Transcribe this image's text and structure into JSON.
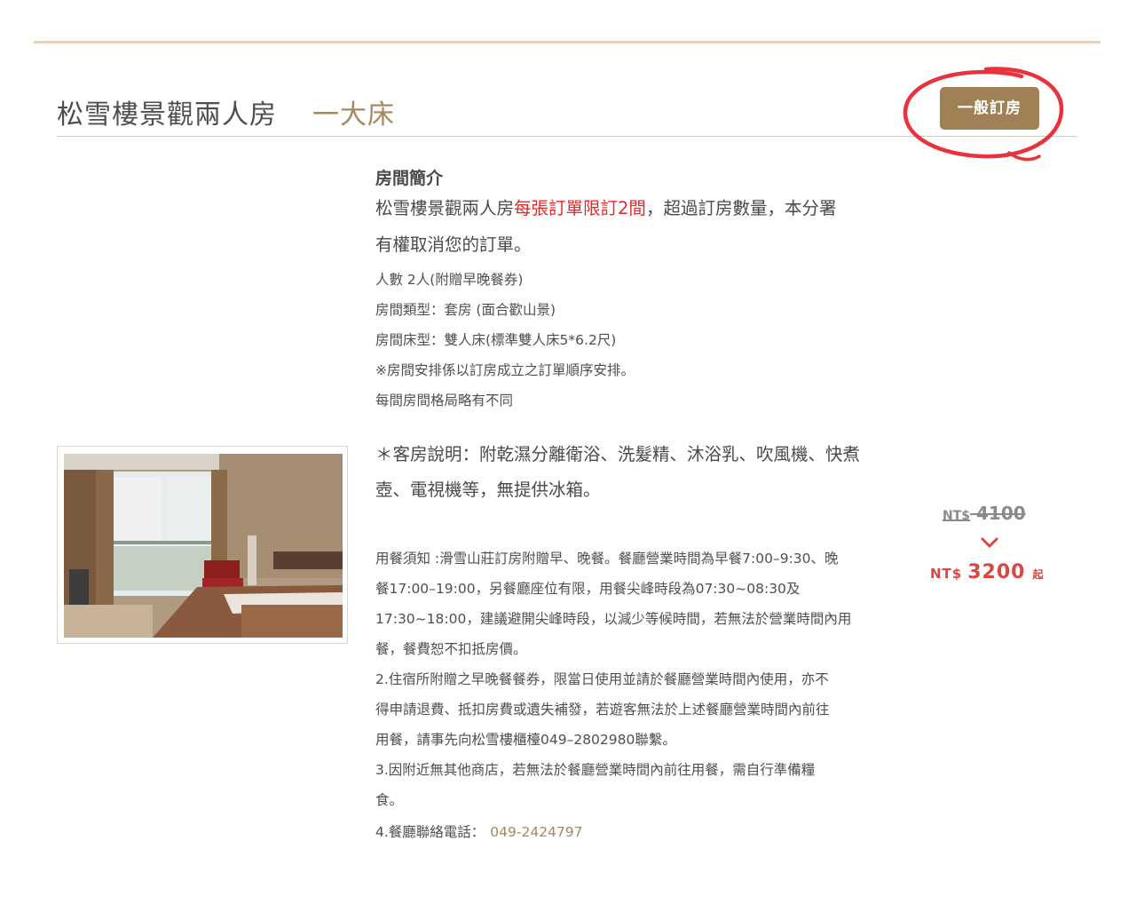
{
  "room": {
    "title": "松雪樓景觀兩人房",
    "bed_type": "一大床",
    "book_button": "一般訂房"
  },
  "intro": {
    "heading": "房間簡介",
    "line1_prefix": "松雪樓景觀兩人房",
    "line1_highlight": "每張訂單限訂2間",
    "line1_suffix": "，超過訂房數量，本分署",
    "line2": "有權取消您的訂單。",
    "details": [
      "人數 2人(附贈早晚餐券)",
      "房間類型：套房 (面合歡山景)",
      "房間床型：雙人床(標準雙人床5*6.2尺)",
      "※房間安排係以訂房成立之訂單順序安排。",
      "每間房間格局略有不同"
    ]
  },
  "description": {
    "line1": "＊客房說明：附乾濕分離衛浴、洗髮精、沐浴乳、吹風機、快煮",
    "line2": "壺、電視機等，無提供冰箱。"
  },
  "notes": [
    "用餐須知 :滑雪山莊訂房附贈早、晚餐。餐廳營業時間為早餐7:00–9:30、晚",
    "餐17:00–19:00，另餐廳座位有限，用餐尖峰時段為07:30~08:30及",
    "17:30~18:00，建議避開尖峰時段，以減少等候時間，若無法於營業時間內用",
    "餐，餐費恕不扣抵房價。",
    "2.住宿所附贈之早晚餐餐券，限當日使用並請於餐廳營業時間內使用，亦不",
    "得申請退費、抵扣房費或遺失補發，若遊客無法於上述餐廳營業時間內前往",
    "用餐，請事先向松雪樓櫃檯049–2802980聯繫。",
    "3.因附近無其他商店，若無法於餐廳營業時間內前往用餐，需自行準備糧",
    "食。"
  ],
  "restaurant_phone": {
    "label": "4.餐廳聯絡電話：",
    "number": "049-2424797"
  },
  "price": {
    "currency": "NT$",
    "original": "4100",
    "discounted": "3200",
    "suffix": "起"
  },
  "colors": {
    "accent": "#a08155",
    "gold_text": "#a4885e",
    "highlight_red": "#e02a2a",
    "price_red": "#d9473f",
    "annotation_circle": "#e8333f"
  }
}
